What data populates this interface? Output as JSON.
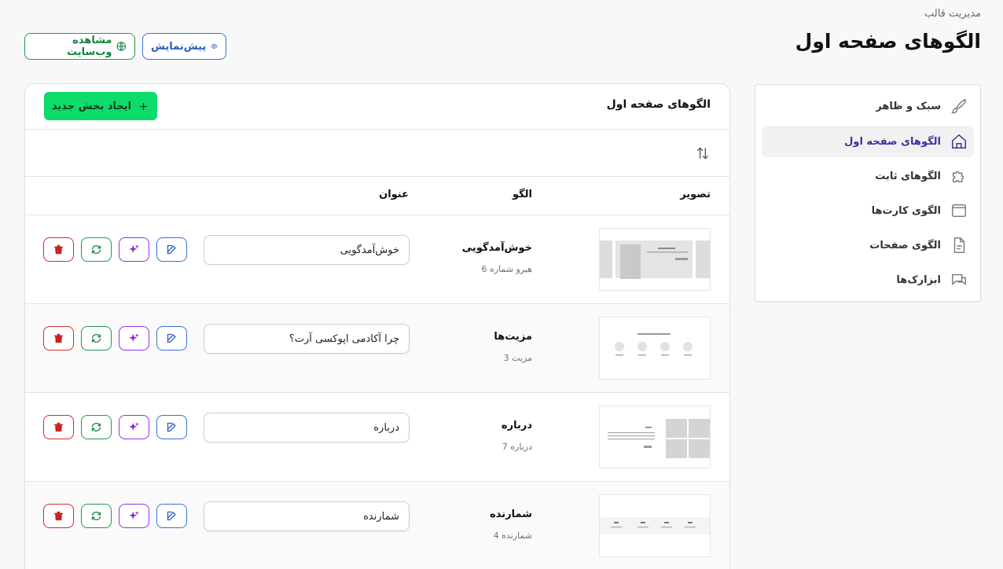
{
  "header": {
    "breadcrumb": "مدیریت قالب",
    "title": "الگوهای صفحه اول",
    "preview_label": "پیش‌نمایش",
    "view_site_label": "مشاهده وب‌سایت"
  },
  "sidebar": {
    "items": [
      {
        "label": "سبک و ظاهر",
        "icon": "brush-icon"
      },
      {
        "label": "الگوهای صفحه اول",
        "icon": "home-icon",
        "active": true
      },
      {
        "label": "الگوهای ثابت",
        "icon": "puzzle-icon"
      },
      {
        "label": "الگوی کارت‌ها",
        "icon": "window-icon"
      },
      {
        "label": "الگوی صفحات",
        "icon": "document-icon"
      },
      {
        "label": "ابزارک‌ها",
        "icon": "chat-icon"
      }
    ]
  },
  "panel": {
    "title": "الگوهای صفحه اول",
    "new_button": "ایجاد بخش جدید",
    "columns": {
      "image": "تصویر",
      "pattern": "الگو",
      "title": "عنوان"
    }
  },
  "rows": [
    {
      "name": "خوش‌آمدگویی",
      "sub": "هیرو شماره 6",
      "title_value": "خوش‌آمدگویی",
      "thumb": "hero"
    },
    {
      "name": "مزیت‌ها",
      "sub": "مزیت 3",
      "title_value": "چرا آکادمی اپوکسی آرت؟",
      "thumb": "features"
    },
    {
      "name": "درباره",
      "sub": "درباره 7",
      "title_value": "درباره",
      "thumb": "about"
    },
    {
      "name": "شمارنده",
      "sub": "شمارنده 4",
      "title_value": "شمارنده",
      "thumb": "counter"
    }
  ],
  "colors": {
    "accent_green": "#0bdc6a",
    "active_text": "#3b34a0",
    "edit_blue": "#2a5bc4",
    "magic_purple": "#8a21d6",
    "sync_green": "#16803c",
    "delete_red": "#d01f1f"
  }
}
